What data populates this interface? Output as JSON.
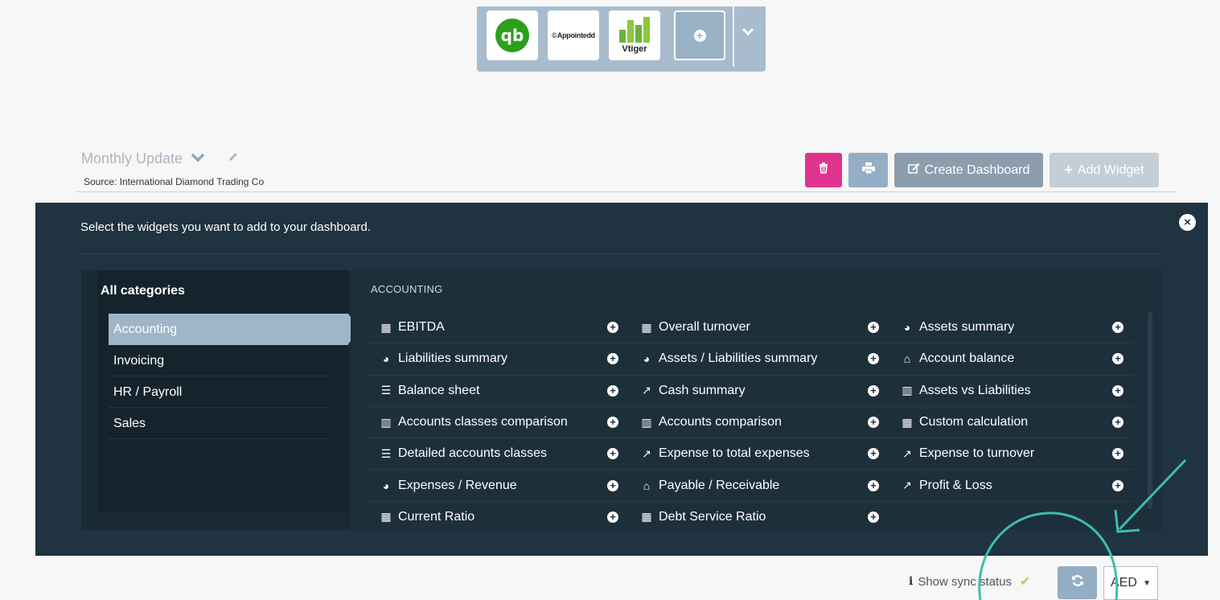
{
  "integrations": {
    "items": [
      {
        "name": "qb"
      },
      {
        "name": "Appointedd"
      },
      {
        "name": "Vtiger"
      }
    ],
    "add_icon": "plus-circle-icon",
    "toggle_icon": "chevron-down-icon"
  },
  "dashboard": {
    "title": "Monthly Update",
    "source_label": "Source:",
    "source_value": "International Diamond Trading Co"
  },
  "toolbar": {
    "create_label": "Create Dashboard",
    "add_label": "Add Widget"
  },
  "panel": {
    "instruction": "Select the widgets you want to add to your dashboard.",
    "categories_header": "All categories",
    "categories": [
      "Accounting",
      "Invoicing",
      "HR / Payroll",
      "Sales"
    ],
    "active_category": "Accounting",
    "section_heading": "ACCOUNTING",
    "widgets": [
      {
        "label": "EBITDA",
        "icon": "calculator-icon"
      },
      {
        "label": "Overall turnover",
        "icon": "calculator-icon"
      },
      {
        "label": "Assets summary",
        "icon": "pie-chart-icon"
      },
      {
        "label": "Liabilities summary",
        "icon": "pie-chart-icon"
      },
      {
        "label": "Assets / Liabilities summary",
        "icon": "pie-chart-icon"
      },
      {
        "label": "Account balance",
        "icon": "bank-icon"
      },
      {
        "label": "Balance sheet",
        "icon": "list-icon"
      },
      {
        "label": "Cash summary",
        "icon": "line-chart-icon"
      },
      {
        "label": "Assets vs Liabilities",
        "icon": "bar-chart-icon"
      },
      {
        "label": "Accounts classes comparison",
        "icon": "bar-chart-icon"
      },
      {
        "label": "Accounts comparison",
        "icon": "bar-chart-icon"
      },
      {
        "label": "Custom calculation",
        "icon": "calculator-icon"
      },
      {
        "label": "Detailed accounts classes",
        "icon": "list-icon"
      },
      {
        "label": "Expense to total expenses",
        "icon": "line-chart-icon"
      },
      {
        "label": "Expense to turnover",
        "icon": "line-chart-icon"
      },
      {
        "label": "Expenses / Revenue",
        "icon": "pie-chart-icon"
      },
      {
        "label": "Payable / Receivable",
        "icon": "bank-icon"
      },
      {
        "label": "Profit & Loss",
        "icon": "line-chart-icon"
      },
      {
        "label": "Current Ratio",
        "icon": "calculator-icon"
      },
      {
        "label": "Debt Service Ratio",
        "icon": "calculator-icon"
      },
      {
        "label": "",
        "icon": ""
      }
    ]
  },
  "footer": {
    "sync_label": "Show sync status",
    "currency": "AED"
  },
  "colors": {
    "panel_bg": "#1f3340",
    "delete": "#e0338d",
    "accent": "#93aec5",
    "annotation": "#3cbfa8"
  }
}
